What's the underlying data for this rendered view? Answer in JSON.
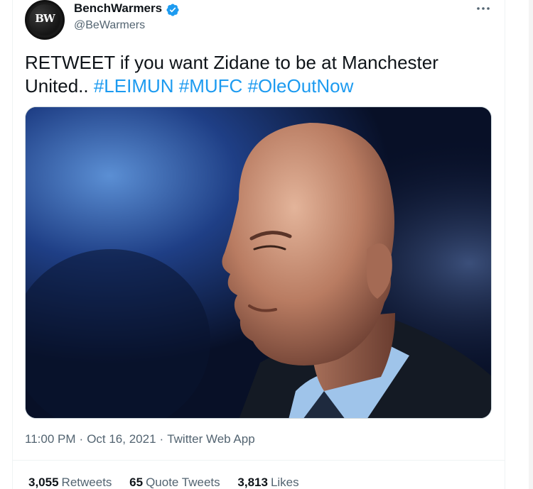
{
  "account": {
    "display_name": "BenchWarmers",
    "handle": "@BeWarmers",
    "avatar_text": "BW",
    "verified": true
  },
  "tweet": {
    "text_before": "RETWEET if you want Zidane to be at Manchester United.. ",
    "hashtags": [
      "#LEIMUN",
      "#MUFC",
      "#OleOutNow"
    ]
  },
  "media": {
    "alt": "Zinedine Zidane"
  },
  "meta": {
    "time": "11:00 PM",
    "date": "Oct 16, 2021",
    "separator": "·",
    "source": "Twitter Web App"
  },
  "stats": {
    "retweets": {
      "count": "3,055",
      "label": "Retweets"
    },
    "quote_tweets": {
      "count": "65",
      "label": "Quote Tweets"
    },
    "likes": {
      "count": "3,813",
      "label": "Likes"
    }
  },
  "colors": {
    "accent": "#1d9bf0",
    "text": "#0f1419",
    "secondary": "#536471",
    "verified": "#1d9bf0"
  },
  "icons": {
    "verified": "verified-badge-icon",
    "more": "more-horizontal-icon"
  }
}
